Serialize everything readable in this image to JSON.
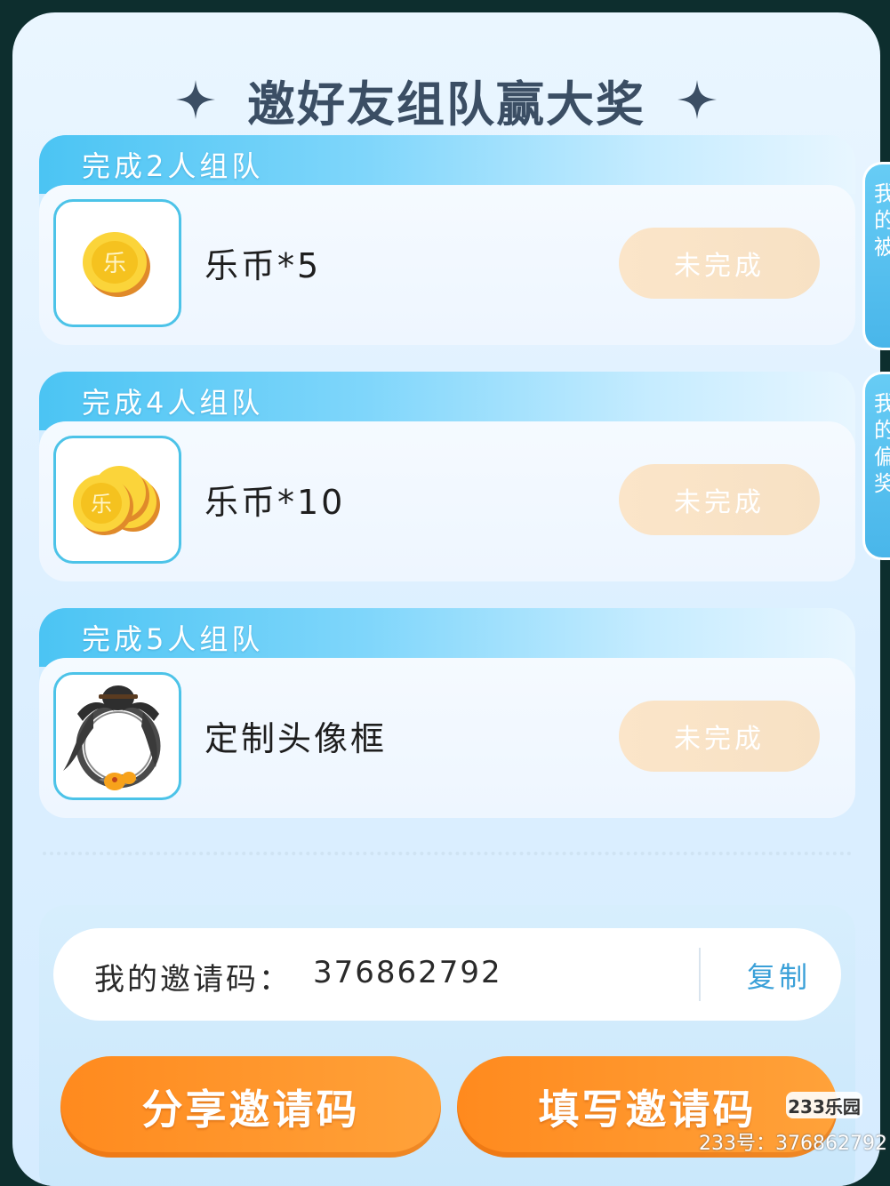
{
  "header": {
    "title": "邀好友组队赢大奖"
  },
  "tiers": [
    {
      "condition": "完成2人组队",
      "reward": "乐币*5",
      "status": "未完成",
      "icon": "single-coin-icon"
    },
    {
      "condition": "完成4人组队",
      "reward": "乐币*10",
      "status": "未完成",
      "icon": "coin-stack-icon"
    },
    {
      "condition": "完成5人组队",
      "reward": "定制头像框",
      "status": "未完成",
      "icon": "avatar-frame-icon"
    }
  ],
  "invite": {
    "label": "我的邀请码：",
    "code": "376862792",
    "copy_label": "复制"
  },
  "actions": {
    "share_label": "分享邀请码",
    "fill_label": "填写邀请码"
  },
  "side_tabs": [
    "我的被",
    "我的偏奖"
  ],
  "watermark": {
    "logo": "233乐园",
    "text": "233号：376862792"
  },
  "colors": {
    "accent_blue": "#4bc4f3",
    "button_orange": "#ff8a1e",
    "status_disabled": "#fbe5c9",
    "title_text": "#3b4e64"
  }
}
